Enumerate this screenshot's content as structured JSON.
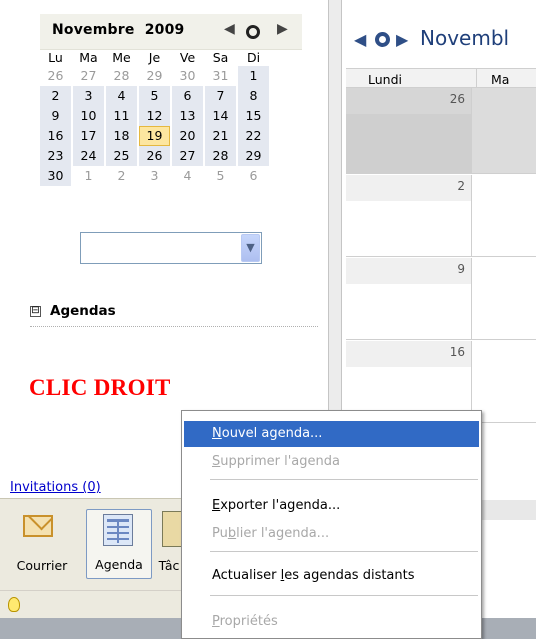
{
  "mini_calendar": {
    "month": "Novembre",
    "year": "2009",
    "weekday_headers": [
      "Lu",
      "Ma",
      "Me",
      "Je",
      "Ve",
      "Sa",
      "Di"
    ],
    "weeks": [
      [
        "26",
        "27",
        "28",
        "29",
        "30",
        "31",
        "1"
      ],
      [
        "2",
        "3",
        "4",
        "5",
        "6",
        "7",
        "8"
      ],
      [
        "9",
        "10",
        "11",
        "12",
        "13",
        "14",
        "15"
      ],
      [
        "16",
        "17",
        "18",
        "19",
        "20",
        "21",
        "22"
      ],
      [
        "23",
        "24",
        "25",
        "26",
        "27",
        "28",
        "29"
      ],
      [
        "30",
        "1",
        "2",
        "3",
        "4",
        "5",
        "6"
      ]
    ],
    "today": "19"
  },
  "calendar_select": {
    "value": ""
  },
  "agendas_section": {
    "label": "Agendas",
    "expand_glyph": "⊟"
  },
  "annotation": {
    "text": "CLIC DROIT",
    "color": "#ff0000"
  },
  "invitations_link": {
    "text": "Invitations (0)"
  },
  "switcher": {
    "courrier": "Courrier",
    "agenda": "Agenda",
    "taches": "Tâc"
  },
  "right_pane": {
    "title": "Novembl",
    "columns": [
      "Lundi",
      "Ma"
    ],
    "week_days": [
      "26",
      "2",
      "9",
      "16"
    ]
  },
  "context_menu": {
    "items": [
      {
        "label": "Nouvel agenda...",
        "accel": "N",
        "rest": "ouvel agenda...",
        "state": "highlighted"
      },
      {
        "label": "Supprimer l'agenda",
        "accel": "S",
        "rest": "upprimer l'agenda",
        "state": "disabled"
      },
      {
        "label": "Exporter l'agenda...",
        "accel": "E",
        "rest": "xporter l'agenda...",
        "state": "enabled"
      },
      {
        "label": "Publier l'agenda...",
        "accel": "b",
        "pre": "Pu",
        "rest": "lier l'agenda...",
        "state": "disabled"
      },
      {
        "label": "Actualiser les agendas distants",
        "accel": "l",
        "pre": "Actualiser ",
        "rest": "es agendas distants",
        "state": "enabled"
      },
      {
        "label": "Propriétés",
        "accel": "P",
        "rest": "ropriétés",
        "state": "disabled"
      }
    ]
  },
  "colors": {
    "highlight": "#316ac5",
    "today_fill": "#fde6a0",
    "link": "#0000cc"
  }
}
